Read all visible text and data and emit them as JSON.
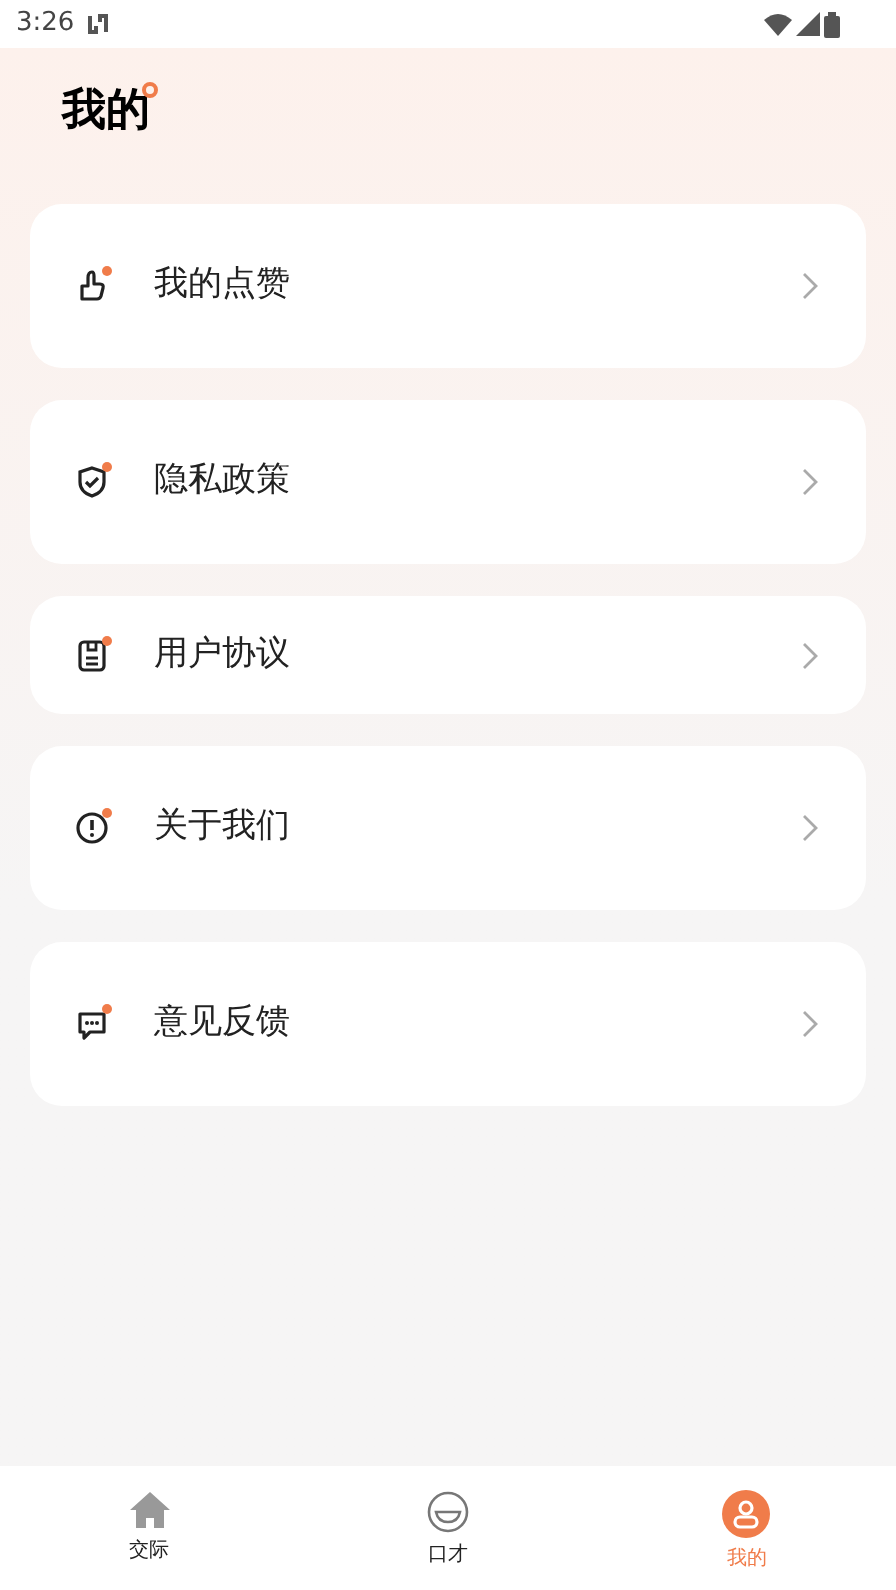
{
  "status_bar": {
    "time": "3:26"
  },
  "title": "我的",
  "menu": [
    {
      "kind": "like",
      "label": "我的点赞"
    },
    {
      "kind": "shield",
      "label": "隐私政策"
    },
    {
      "kind": "doc",
      "label": "用户协议"
    },
    {
      "kind": "info",
      "label": "关于我们"
    },
    {
      "kind": "chat",
      "label": "意见反馈"
    }
  ],
  "tabs": [
    {
      "kind": "home",
      "label": "交际",
      "selected": false
    },
    {
      "kind": "face",
      "label": "口才",
      "selected": false
    },
    {
      "kind": "person",
      "label": "我的",
      "selected": true
    }
  ]
}
